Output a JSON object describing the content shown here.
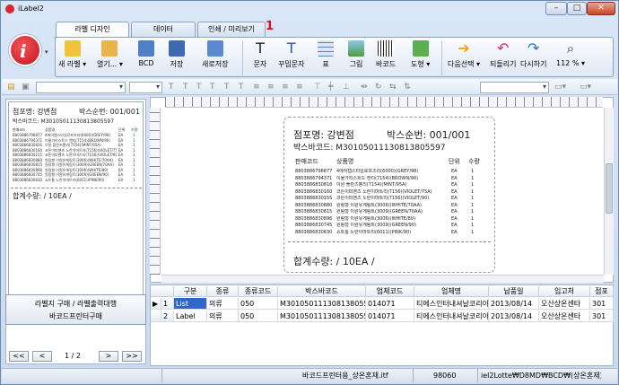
{
  "window": {
    "title": "iLabel2",
    "min": "–",
    "max": "□",
    "close": "✕"
  },
  "tabs": [
    {
      "label": "라벨 디자인"
    },
    {
      "label": "데이터"
    },
    {
      "label": "인쇄 / 미리보기"
    }
  ],
  "tab_marker": "1",
  "ribbon": {
    "new_label": "새 라벨",
    "open": "열기...",
    "bcd": "BCD",
    "save": "저장",
    "save_as": "새로저장",
    "text": "문자",
    "decorated_text": "꾸밈문자",
    "table": "표",
    "image": "그림",
    "barcode": "바코드",
    "shape": "도형",
    "next_select": "다음선택",
    "undo": "되돌리기",
    "redo": "다시하기",
    "zoom": "112 %"
  },
  "thumbnail": {
    "store": "점포명: 강변점",
    "box_no": "박스순번: 001/001",
    "box_barcode": "박스바코드: M3010501113081380​5597",
    "col_code": "판매코드",
    "col_name": "상품명",
    "col_unit": "단위",
    "col_qty": "수량",
    "total": "합계수량:  / 10EA /"
  },
  "left_buttons": {
    "line1": "라벨지 구매 / 라벨출력대행",
    "line2": "바코드프린터구매"
  },
  "pager": {
    "first": "<<",
    "prev": "<",
    "page": "1 / 2",
    "next": ">",
    "last": ">>"
  },
  "label": {
    "store": "점포명: 강변점",
    "box_no": "박스순번: 001/001",
    "box_barcode": "박스바코드: M3010501113081380​5597",
    "col_code": "판매코드",
    "col_name": "상품명",
    "col_unit": "단위",
    "col_qty": "수량",
    "rows": [
      {
        "code": "8803886798877",
        "name": "4에어캡스타일로프츠리(6000)(GREY/98)",
        "unit": "EA",
        "qty": "1"
      },
      {
        "code": "8803886794371",
        "name": "이물가리스트드 캔티(7154)(BROWN/90)",
        "unit": "EA",
        "qty": "1"
      },
      {
        "code": "8803886830816",
        "name": "이원 플란츠뽕리(7154)(MINT/95A)",
        "unit": "EA",
        "qty": "1"
      },
      {
        "code": "8803886830160",
        "name": "코튼이피밴츠 노란이마트리(7156)(VIOLET/75A)",
        "unit": "EA",
        "qty": "1"
      },
      {
        "code": "8803886830155",
        "name": "코튼이피밴츠 노란이마트리(7156)(VIOLET/90)",
        "unit": "EA",
        "qty": "1"
      },
      {
        "code": "8803886830880",
        "name": "원림형 이원유게림트(3006)(WHITE/70AA)",
        "unit": "EA",
        "qty": "1"
      },
      {
        "code": "8803886830815",
        "name": "원림형 이원유게림트(3009)(GREEN/70AA)",
        "unit": "EA",
        "qty": "1"
      },
      {
        "code": "8803886830896",
        "name": "원림형 이원유게림트(3006)(WHITE/80)",
        "unit": "EA",
        "qty": "1"
      },
      {
        "code": "8803886830745",
        "name": "원림형 이원유게림트(3009)(GREEN/90)",
        "unit": "EA",
        "qty": "1"
      },
      {
        "code": "8803886830630",
        "name": "쇼트통 노란이마트리(6011)(PINK/90)",
        "unit": "EA",
        "qty": "1"
      }
    ],
    "total": "합계수량:  / 10EA /"
  },
  "grid": {
    "headers": [
      "구분",
      "종류",
      "종류코드",
      "박스바코드",
      "업체코드",
      "업체명",
      "납품일",
      "입고처",
      "점포"
    ],
    "rows": [
      {
        "indicator": "▶",
        "num": "1",
        "cells": [
          "List",
          "의류",
          "050",
          "M3010501113081380​5597",
          "014071",
          "티에스인터내셔날코리아(주)",
          "2013/08/14",
          "오산상온센타",
          "301"
        ]
      },
      {
        "indicator": "",
        "num": "2",
        "cells": [
          "Label",
          "의류",
          "050",
          "M3010501113081380​5597",
          "014071",
          "티에스인터내셔날코리아(주)",
          "2013/08/14",
          "오산상온센타",
          "301"
        ]
      }
    ]
  },
  "status": {
    "file": "바코드프린터용_상온혼재.itf",
    "num": "98060",
    "path": "iel2Lotte₩D8MD₩BCD₩(상온혼재)₩"
  },
  "colors": {
    "accent": "#d8262e",
    "frame": "#c9daf0"
  }
}
